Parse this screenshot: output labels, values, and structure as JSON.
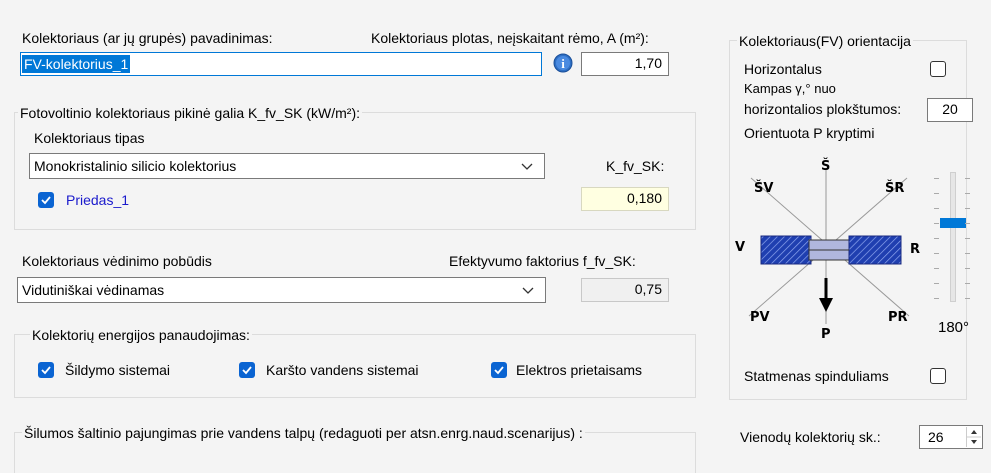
{
  "collector": {
    "name_label": "Kolektoriaus (ar jų grupės) pavadinimas:",
    "name_value": "FV-kolektorius_1",
    "area_label": "Kolektoriaus plotas, neįskaitant rėmo, A (m²):",
    "area_value": "1,70"
  },
  "peak_power": {
    "group_label": "Fotovoltinio kolektoriaus pikinė galia K_fv_SK (kW/m²):",
    "type_label": "Kolektoriaus tipas",
    "type_value": "Monokristalinio silicio kolektorius",
    "k_label": "K_fv_SK:",
    "k_value": "0,180",
    "addon_label": "Priedas_1",
    "addon_checked": true
  },
  "ventilation": {
    "label": "Kolektoriaus vėdinimo pobūdis",
    "value": "Vidutiniškai vėdinamas",
    "efficiency_label": "Efektyvumo faktorius f_fv_SK:",
    "efficiency_value": "0,75"
  },
  "energy_use": {
    "group_label": "Kolektorių energijos panaudojimas:",
    "options": [
      {
        "label": "Šildymo sistemai",
        "checked": true
      },
      {
        "label": "Karšto vandens sistemai",
        "checked": true
      },
      {
        "label": "Elektros prietaisams",
        "checked": true
      }
    ]
  },
  "heat_source": {
    "group_label": "Šilumos šaltinio pajungimas prie vandens talpų (redaguoti per atsn.enrg.naud.scenarijus) :"
  },
  "orientation": {
    "group_label": "Kolektoriaus(FV) orientacija",
    "horizontal_label": "Horizontalus",
    "horizontal_checked": false,
    "angle_label_line1": "Kampas  γ,° nuo",
    "angle_label_line2": "horizontalios plokštumos:",
    "angle_value": "20",
    "direction_label": "Orientuota P kryptimi",
    "compass": {
      "N": "Š",
      "NW": "ŠV",
      "NE": "ŠR",
      "W": "V",
      "E": "R",
      "SW": "PV",
      "SE": "PR",
      "S": "P"
    },
    "slider_value": "180°",
    "slider_level": 0.38,
    "perpendicular_label": "Statmenas spinduliams",
    "perpendicular_checked": false,
    "count_label": "Vienodų kolektorių sk.:",
    "count_value": "26"
  },
  "colors": {
    "accent": "#0a64d2",
    "selection": "#0078d7",
    "link": "#1a1acc",
    "highlight": "#ffffe1"
  }
}
